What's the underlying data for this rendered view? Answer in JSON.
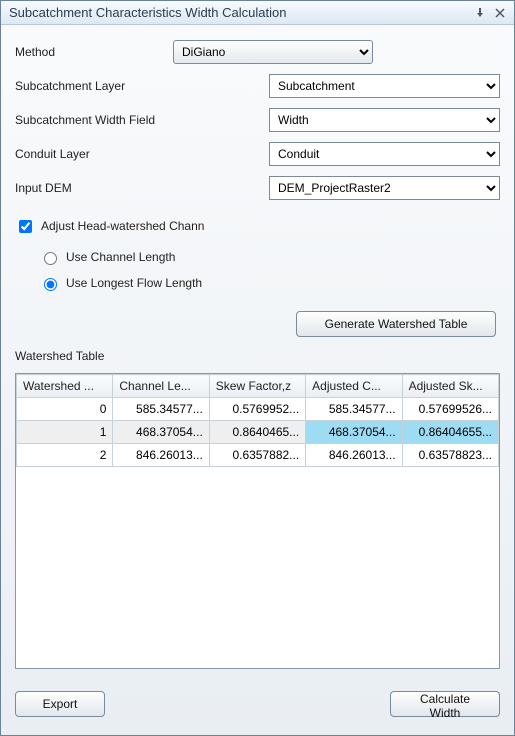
{
  "window": {
    "title": "Subcatchment Characteristics Width Calculation"
  },
  "labels": {
    "method": "Method",
    "subcatchment_layer": "Subcatchment Layer",
    "subcatchment_width_field": "Subcatchment Width Field",
    "conduit_layer": "Conduit Layer",
    "input_dem": "Input DEM",
    "adjust_head": "Adjust  Head-watershed Chann",
    "use_channel_length": "Use Channel Length",
    "use_longest_flow_length": "Use Longest Flow Length",
    "watershed_table": "Watershed Table"
  },
  "combos": {
    "method": "DiGiano",
    "subcatchment_layer": "Subcatchment",
    "subcatchment_width_field": "Width",
    "conduit_layer": "Conduit",
    "input_dem": "DEM_ProjectRaster2"
  },
  "checks": {
    "adjust_head": true
  },
  "radios": {
    "selected": "use_longest_flow_length"
  },
  "buttons": {
    "generate": "Generate Watershed Table",
    "export": "Export",
    "calculate_width": "Calculate Width"
  },
  "table": {
    "headers": [
      "Watershed ...",
      "Channel Le...",
      "Skew Factor,z",
      "Adjusted C...",
      "Adjusted Sk..."
    ],
    "rows": [
      {
        "cells": [
          "0",
          "585.34577...",
          "0.5769952...",
          "585.34577...",
          "0.57699526..."
        ],
        "selected": false,
        "highlight_cols": []
      },
      {
        "cells": [
          "1",
          "468.37054...",
          "0.8640465...",
          "468.37054...",
          "0.86404655..."
        ],
        "selected": true,
        "highlight_cols": [
          3,
          4
        ]
      },
      {
        "cells": [
          "2",
          "846.26013...",
          "0.6357882...",
          "846.26013...",
          "0.63578823..."
        ],
        "selected": false,
        "highlight_cols": []
      }
    ]
  }
}
